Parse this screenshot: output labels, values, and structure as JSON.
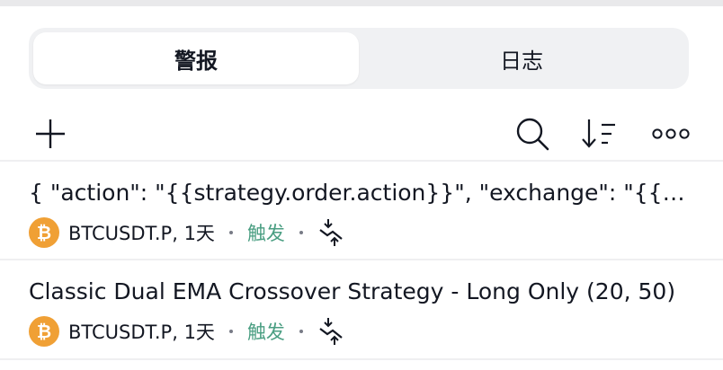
{
  "colors": {
    "status_green": "#4a9e82",
    "coin_orange": "#f0a035",
    "text": "#131722"
  },
  "tabs": [
    {
      "label": "警报",
      "active": true
    },
    {
      "label": "日志",
      "active": false
    }
  ],
  "toolbar": {
    "add_icon": "plus-icon",
    "search_icon": "search-icon",
    "sort_icon": "sort-icon",
    "more_icon": "more-icon"
  },
  "alerts": [
    {
      "title": "{ \"action\": \"{{strategy.order.action}}\", \"exchange\": \"{{exchange}}\" }",
      "symbol": "BTCUSDT.P, 1天",
      "status": "触发",
      "coin_icon": "bitcoin-icon",
      "condition_icon": "crossing-icon"
    },
    {
      "title": "Classic Dual EMA Crossover Strategy - Long Only (20, 50)",
      "symbol": "BTCUSDT.P, 1天",
      "status": "触发",
      "coin_icon": "bitcoin-icon",
      "condition_icon": "crossing-icon"
    }
  ]
}
